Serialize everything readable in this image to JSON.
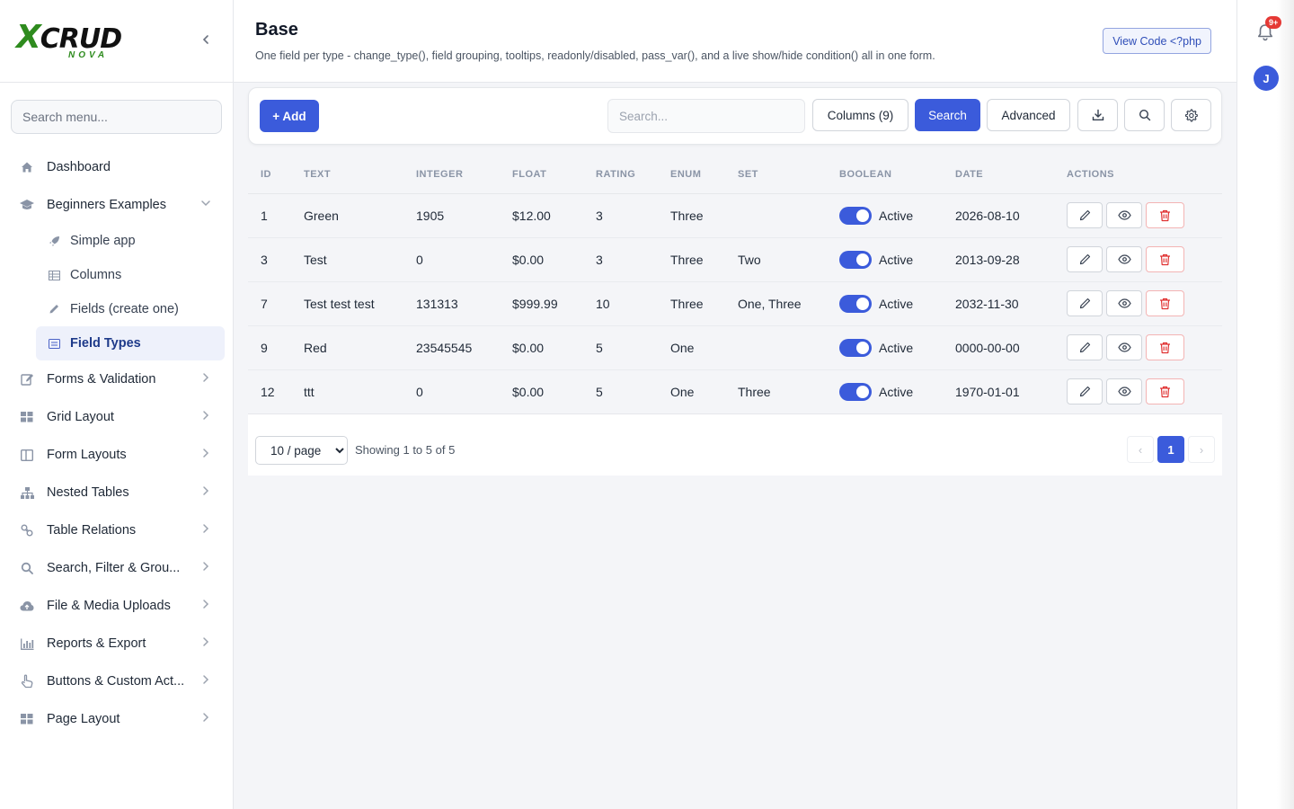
{
  "brand": {
    "logo_main_x": "X",
    "logo_main_rest": "CRUD",
    "logo_sub": "NOVA"
  },
  "sidebar": {
    "search_placeholder": "Search menu...",
    "items": [
      {
        "label": "Dashboard",
        "icon": "home-icon",
        "has_chevron": false
      },
      {
        "label": "Beginners Examples",
        "icon": "graduation-cap-icon",
        "has_chevron": true,
        "expanded": true,
        "children": [
          {
            "label": "Simple app",
            "icon": "rocket-icon"
          },
          {
            "label": "Columns",
            "icon": "table-icon"
          },
          {
            "label": "Fields (create one)",
            "icon": "pencil-icon"
          },
          {
            "label": "Field Types",
            "icon": "list-icon",
            "active": true
          }
        ]
      },
      {
        "label": "Forms & Validation",
        "icon": "edit-icon",
        "has_chevron": true
      },
      {
        "label": "Grid Layout",
        "icon": "grid-icon",
        "has_chevron": true
      },
      {
        "label": "Form Layouts",
        "icon": "columns-icon",
        "has_chevron": true
      },
      {
        "label": "Nested Tables",
        "icon": "sitemap-icon",
        "has_chevron": true
      },
      {
        "label": "Table Relations",
        "icon": "link-icon",
        "has_chevron": true
      },
      {
        "label": "Search, Filter & Grou...",
        "icon": "search-icon",
        "has_chevron": true
      },
      {
        "label": "File & Media Uploads",
        "icon": "cloud-upload-icon",
        "has_chevron": true
      },
      {
        "label": "Reports & Export",
        "icon": "chart-icon",
        "has_chevron": true
      },
      {
        "label": "Buttons & Custom Act...",
        "icon": "pointer-icon",
        "has_chevron": true
      },
      {
        "label": "Page Layout",
        "icon": "grid-icon",
        "has_chevron": true
      }
    ]
  },
  "header": {
    "title": "Base",
    "description": "One field per type - change_type(), field grouping, tooltips, readonly/disabled, pass_var(), and a live show/hide condition() all in one form.",
    "view_code_label": "View Code <?php"
  },
  "rail": {
    "notification_badge": "9+",
    "avatar_initial": "J"
  },
  "toolbar": {
    "add_label": "+ Add",
    "search_placeholder": "Search...",
    "columns_label": "Columns (9)",
    "search_button": "Search",
    "advanced_label": "Advanced"
  },
  "table": {
    "columns": [
      "ID",
      "TEXT",
      "INTEGER",
      "FLOAT",
      "RATING",
      "ENUM",
      "SET",
      "BOOLEAN",
      "DATE",
      "ACTIONS"
    ],
    "rows": [
      {
        "id": "1",
        "text": "Green",
        "integer": "1905",
        "float": "$12.00",
        "rating": "3",
        "enum": "Three",
        "set": "",
        "boolean": "Active",
        "boolean_on": true,
        "date": "2026-08-10"
      },
      {
        "id": "3",
        "text": "Test",
        "integer": "0",
        "float": "$0.00",
        "rating": "3",
        "enum": "Three",
        "set": "Two",
        "boolean": "Active",
        "boolean_on": true,
        "date": "2013-09-28"
      },
      {
        "id": "7",
        "text": "Test test test",
        "integer": "131313",
        "float": "$999.99",
        "rating": "10",
        "enum": "Three",
        "set": "One, Three",
        "boolean": "Active",
        "boolean_on": true,
        "date": "2032-11-30"
      },
      {
        "id": "9",
        "text": "Red",
        "integer": "23545545",
        "float": "$0.00",
        "rating": "5",
        "enum": "One",
        "set": "",
        "boolean": "Active",
        "boolean_on": true,
        "date": "0000-00-00"
      },
      {
        "id": "12",
        "text": "ttt",
        "integer": "0",
        "float": "$0.00",
        "rating": "5",
        "enum": "One",
        "set": "Three",
        "boolean": "Active",
        "boolean_on": true,
        "date": "1970-01-01"
      }
    ]
  },
  "footer": {
    "page_size": "10 / page",
    "page_size_options": [
      "10 / page"
    ],
    "showing": "Showing 1 to 5 of 5",
    "pages": [
      "1"
    ],
    "current_page": "1",
    "prev_symbol": "‹",
    "next_symbol": "›"
  },
  "colors": {
    "accent": "#3b5bdb",
    "danger": "#e03131",
    "brand_green": "#2e8b1e"
  }
}
